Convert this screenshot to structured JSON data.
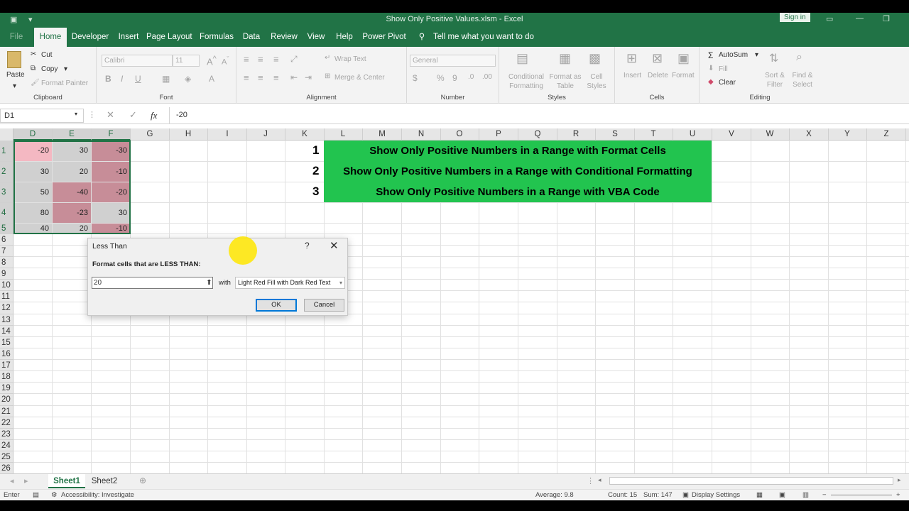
{
  "window": {
    "title": "Show Only Positive Values.xlsm  -  Excel",
    "signin": "Sign in"
  },
  "tabs": [
    "File",
    "Home",
    "Developer",
    "Insert",
    "Page Layout",
    "Formulas",
    "Data",
    "Review",
    "View",
    "Help",
    "Power Pivot"
  ],
  "tell_me": "Tell me what you want to do",
  "ribbon": {
    "clipboard": {
      "paste": "Paste",
      "cut": "Cut",
      "copy": "Copy",
      "format_painter": "Format Painter",
      "label": "Clipboard"
    },
    "font": {
      "name": "Calibri",
      "size": "11",
      "label": "Font"
    },
    "alignment": {
      "wrap": "Wrap Text",
      "merge": "Merge & Center",
      "label": "Alignment"
    },
    "number": {
      "format": "General",
      "label": "Number"
    },
    "styles": {
      "cond": "Conditional Formatting",
      "table": "Format as Table",
      "cell": "Cell Styles",
      "label": "Styles"
    },
    "cells": {
      "insert": "Insert",
      "delete": "Delete",
      "format": "Format",
      "label": "Cells"
    },
    "editing": {
      "autosum": "AutoSum",
      "fill": "Fill",
      "clear": "Clear",
      "sort": "Sort & Filter",
      "find": "Find & Select",
      "label": "Editing"
    }
  },
  "formula_bar": {
    "name_box": "D1",
    "formula": "-20",
    "fx": "fx"
  },
  "columns": [
    "D",
    "E",
    "F",
    "G",
    "H",
    "I",
    "J",
    "K",
    "L",
    "M",
    "N",
    "O",
    "P",
    "Q",
    "R",
    "S",
    "T",
    "U",
    "V",
    "W",
    "X",
    "Y",
    "Z"
  ],
  "rows": [
    "1",
    "2",
    "3",
    "4",
    "5",
    "6",
    "7",
    "8",
    "9",
    "10",
    "11",
    "12",
    "13",
    "14",
    "15",
    "16",
    "17",
    "18",
    "19",
    "20",
    "21",
    "22",
    "23",
    "24",
    "25",
    "26"
  ],
  "cells": [
    [
      "-20",
      "30",
      "-30"
    ],
    [
      "30",
      "20",
      "-10"
    ],
    [
      "50",
      "-40",
      "-20"
    ],
    [
      "80",
      "-23",
      "30"
    ],
    [
      "40",
      "20",
      "-10"
    ]
  ],
  "banner": {
    "items": [
      {
        "num": "1",
        "text": "Show Only Positive Numbers in a Range with Format Cells"
      },
      {
        "num": "2",
        "text": "Show Only Positive Numbers in a Range with Conditional Formatting"
      },
      {
        "num": "3",
        "text": "Show Only Positive Numbers in a Range with VBA Code"
      }
    ],
    "color": "#22c44f"
  },
  "dialog": {
    "title": "Less Than",
    "help": "?",
    "prompt": "Format cells that are LESS THAN:",
    "value": "20",
    "with": "with",
    "format": "Light Red Fill with Dark Red Text",
    "ok": "OK",
    "cancel": "Cancel"
  },
  "sheets": [
    "Sheet1",
    "Sheet2"
  ],
  "status": {
    "mode": "Enter",
    "accessibility": "Accessibility: Investigate",
    "average": "Average: 9.8",
    "count": "Count: 15",
    "sum": "Sum: 147",
    "display": "Display Settings"
  },
  "colors": {
    "excel_green": "#217346",
    "pink_fill": "#f4b8c2",
    "rose_fill": "#c78d98",
    "selection_gray": "#d0d0d0"
  }
}
